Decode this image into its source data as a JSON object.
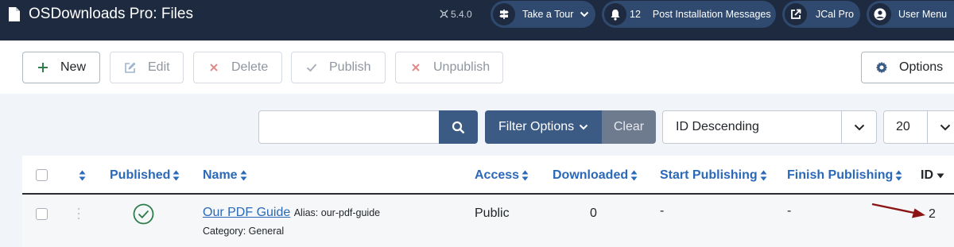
{
  "header": {
    "title": "OSDownloads Pro: Files",
    "version": "5.4.0",
    "take_tour": "Take a Tour",
    "notifications_count": "12",
    "post_install": "Post Installation Messages",
    "jcal": "JCal Pro",
    "user_menu": "User Menu"
  },
  "toolbar": {
    "new": "New",
    "edit": "Edit",
    "delete": "Delete",
    "publish": "Publish",
    "unpublish": "Unpublish",
    "options": "Options"
  },
  "filters": {
    "search_value": "",
    "filter_options": "Filter Options",
    "clear": "Clear",
    "ordering": "ID Descending",
    "limit": "20"
  },
  "table": {
    "columns": {
      "published": "Published",
      "name": "Name",
      "access": "Access",
      "downloaded": "Downloaded",
      "start_publishing": "Start Publishing",
      "finish_publishing": "Finish Publishing",
      "id": "ID"
    },
    "rows": [
      {
        "name": "Our PDF Guide",
        "alias": "Alias: our-pdf-guide",
        "category": "Category: General",
        "access": "Public",
        "downloaded": "0",
        "start_publishing": "-",
        "finish_publishing": "-",
        "id": "2"
      }
    ]
  },
  "colors": {
    "header_bg": "#1d2a3f",
    "accent": "#3b5b85",
    "link": "#2a69b8",
    "published_green": "#2f7d4b",
    "annotation_arrow": "#8b1515"
  },
  "icons": [
    "file-icon",
    "joomla-icon",
    "signpost-icon",
    "bell-icon",
    "external-link-icon",
    "user-icon",
    "plus-icon",
    "pencil-icon",
    "times-icon",
    "check-icon",
    "gear-icon",
    "search-icon",
    "chevron-down-icon",
    "sort-icon",
    "drag-handle-icon",
    "published-check-icon",
    "arrow-annotation"
  ]
}
